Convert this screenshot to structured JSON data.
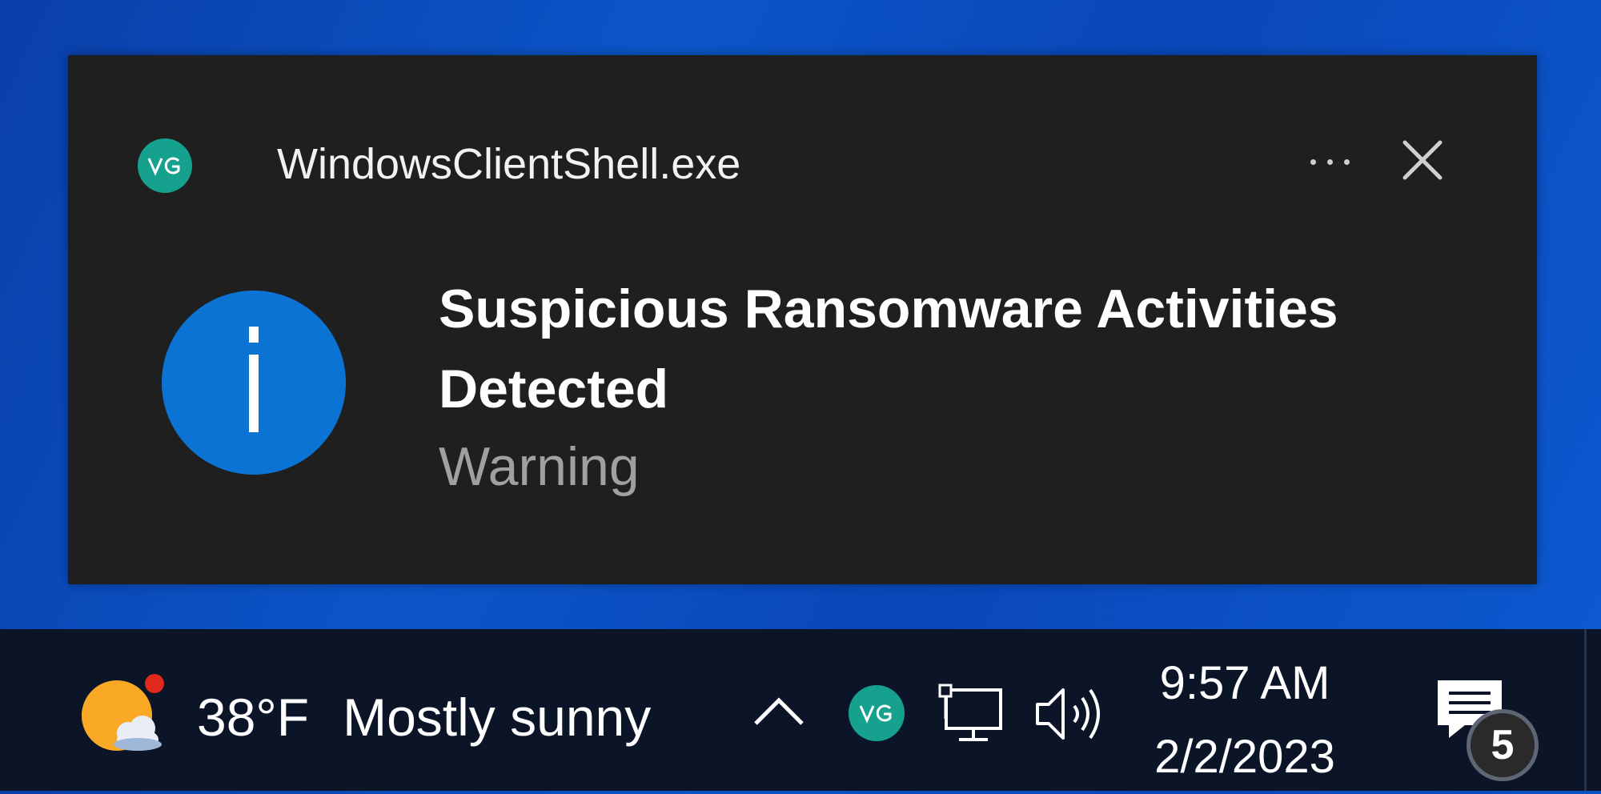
{
  "toast": {
    "app_name": "WindowsClientShell.exe",
    "app_icon": "VG-logo",
    "title": "Suspicious Ransomware Activities Detected",
    "subtitle": "Warning",
    "icon": "info-icon",
    "actions": {
      "more": "more-options-icon",
      "close": "close-icon"
    }
  },
  "taskbar": {
    "weather": {
      "temperature": "38°F",
      "condition": "Mostly sunny",
      "icon": "weather-partly-sunny-icon"
    },
    "tray": {
      "chevron": "chevron-up-icon",
      "app_icon": "VG-logo",
      "network": "network-icon",
      "volume": "volume-icon"
    },
    "clock": {
      "time": "9:57 AM",
      "date": "2/2/2023"
    },
    "notifications": {
      "count": "5",
      "icon": "notification-center-icon"
    }
  },
  "colors": {
    "toast_bg": "#1f1f1f",
    "info_blue": "#0b73d4",
    "app_teal": "#16a08e",
    "taskbar_bg": "#0c1528",
    "desktop_blue": "#0b55c9"
  }
}
